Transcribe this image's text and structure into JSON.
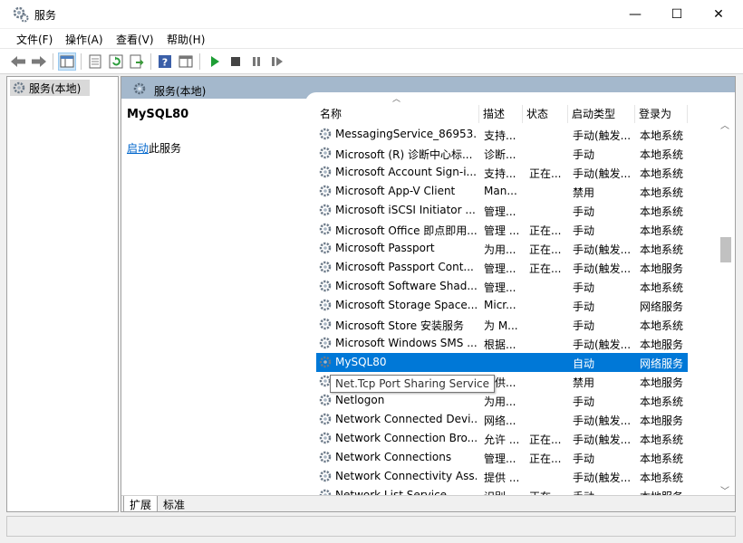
{
  "window": {
    "title": "服务",
    "minimize": "—",
    "maximize": "☐",
    "close": "✕"
  },
  "menu": [
    "文件(F)",
    "操作(A)",
    "查看(V)",
    "帮助(H)"
  ],
  "tree": {
    "root": "服务(本地)"
  },
  "pane": {
    "header": "服务(本地)"
  },
  "detail": {
    "service_name": "MySQL80",
    "action_link": "启动",
    "action_suffix": "此服务"
  },
  "columns": {
    "name": "名称",
    "desc": "描述",
    "state": "状态",
    "start": "启动类型",
    "logon": "登录为"
  },
  "rows": [
    {
      "name": "MessagingService_86953...",
      "desc": "支持...",
      "state": "",
      "start": "手动(触发...",
      "logon": "本地系统"
    },
    {
      "name": "Microsoft (R) 诊断中心标...",
      "desc": "诊断...",
      "state": "",
      "start": "手动",
      "logon": "本地系统"
    },
    {
      "name": "Microsoft Account Sign-i...",
      "desc": "支持...",
      "state": "正在...",
      "start": "手动(触发...",
      "logon": "本地系统"
    },
    {
      "name": "Microsoft App-V Client",
      "desc": "Man...",
      "state": "",
      "start": "禁用",
      "logon": "本地系统"
    },
    {
      "name": "Microsoft iSCSI Initiator ...",
      "desc": "管理...",
      "state": "",
      "start": "手动",
      "logon": "本地系统"
    },
    {
      "name": "Microsoft Office 即点即用...",
      "desc": "管理 ...",
      "state": "正在...",
      "start": "手动",
      "logon": "本地系统"
    },
    {
      "name": "Microsoft Passport",
      "desc": "为用...",
      "state": "正在...",
      "start": "手动(触发...",
      "logon": "本地系统"
    },
    {
      "name": "Microsoft Passport Cont...",
      "desc": "管理...",
      "state": "正在...",
      "start": "手动(触发...",
      "logon": "本地服务"
    },
    {
      "name": "Microsoft Software Shad...",
      "desc": "管理...",
      "state": "",
      "start": "手动",
      "logon": "本地系统"
    },
    {
      "name": "Microsoft Storage Space...",
      "desc": "Micr...",
      "state": "",
      "start": "手动",
      "logon": "网络服务"
    },
    {
      "name": "Microsoft Store 安装服务",
      "desc": "为 M...",
      "state": "",
      "start": "手动",
      "logon": "本地系统"
    },
    {
      "name": "Microsoft Windows SMS ...",
      "desc": "根据...",
      "state": "",
      "start": "手动(触发...",
      "logon": "本地服务"
    },
    {
      "name": "MySQL80",
      "desc": "",
      "state": "",
      "start": "自动",
      "logon": "网络服务",
      "selected": true
    },
    {
      "name": "Net.Tcp Port Sharing Service",
      "desc": "提供...",
      "state": "",
      "start": "禁用",
      "logon": "本地服务"
    },
    {
      "name": "Netlogon",
      "desc": "为用...",
      "state": "",
      "start": "手动",
      "logon": "本地系统"
    },
    {
      "name": "Network Connected Devi...",
      "desc": "网络...",
      "state": "",
      "start": "手动(触发...",
      "logon": "本地服务"
    },
    {
      "name": "Network Connection Bro...",
      "desc": "允许 ...",
      "state": "正在...",
      "start": "手动(触发...",
      "logon": "本地系统"
    },
    {
      "name": "Network Connections",
      "desc": "管理...",
      "state": "正在...",
      "start": "手动",
      "logon": "本地系统"
    },
    {
      "name": "Network Connectivity Ass...",
      "desc": "提供 ...",
      "state": "",
      "start": "手动(触发...",
      "logon": "本地系统"
    },
    {
      "name": "Network List Service",
      "desc": "识别...",
      "state": "正在...",
      "start": "手动",
      "logon": "本地服务"
    }
  ],
  "tooltip": "Net.Tcp Port Sharing Service",
  "tabs": [
    "扩展",
    "标准"
  ],
  "colors": {
    "selection": "#0078d7",
    "pane_header": "#a4b8cc",
    "link": "#0066cc"
  },
  "icons": [
    "gear-icon",
    "back-arrow-icon",
    "forward-arrow-icon",
    "console-tree-icon",
    "properties-icon",
    "refresh-icon",
    "export-icon",
    "help-icon",
    "show-hide-icon",
    "play-icon",
    "stop-icon",
    "pause-icon",
    "restart-icon"
  ]
}
